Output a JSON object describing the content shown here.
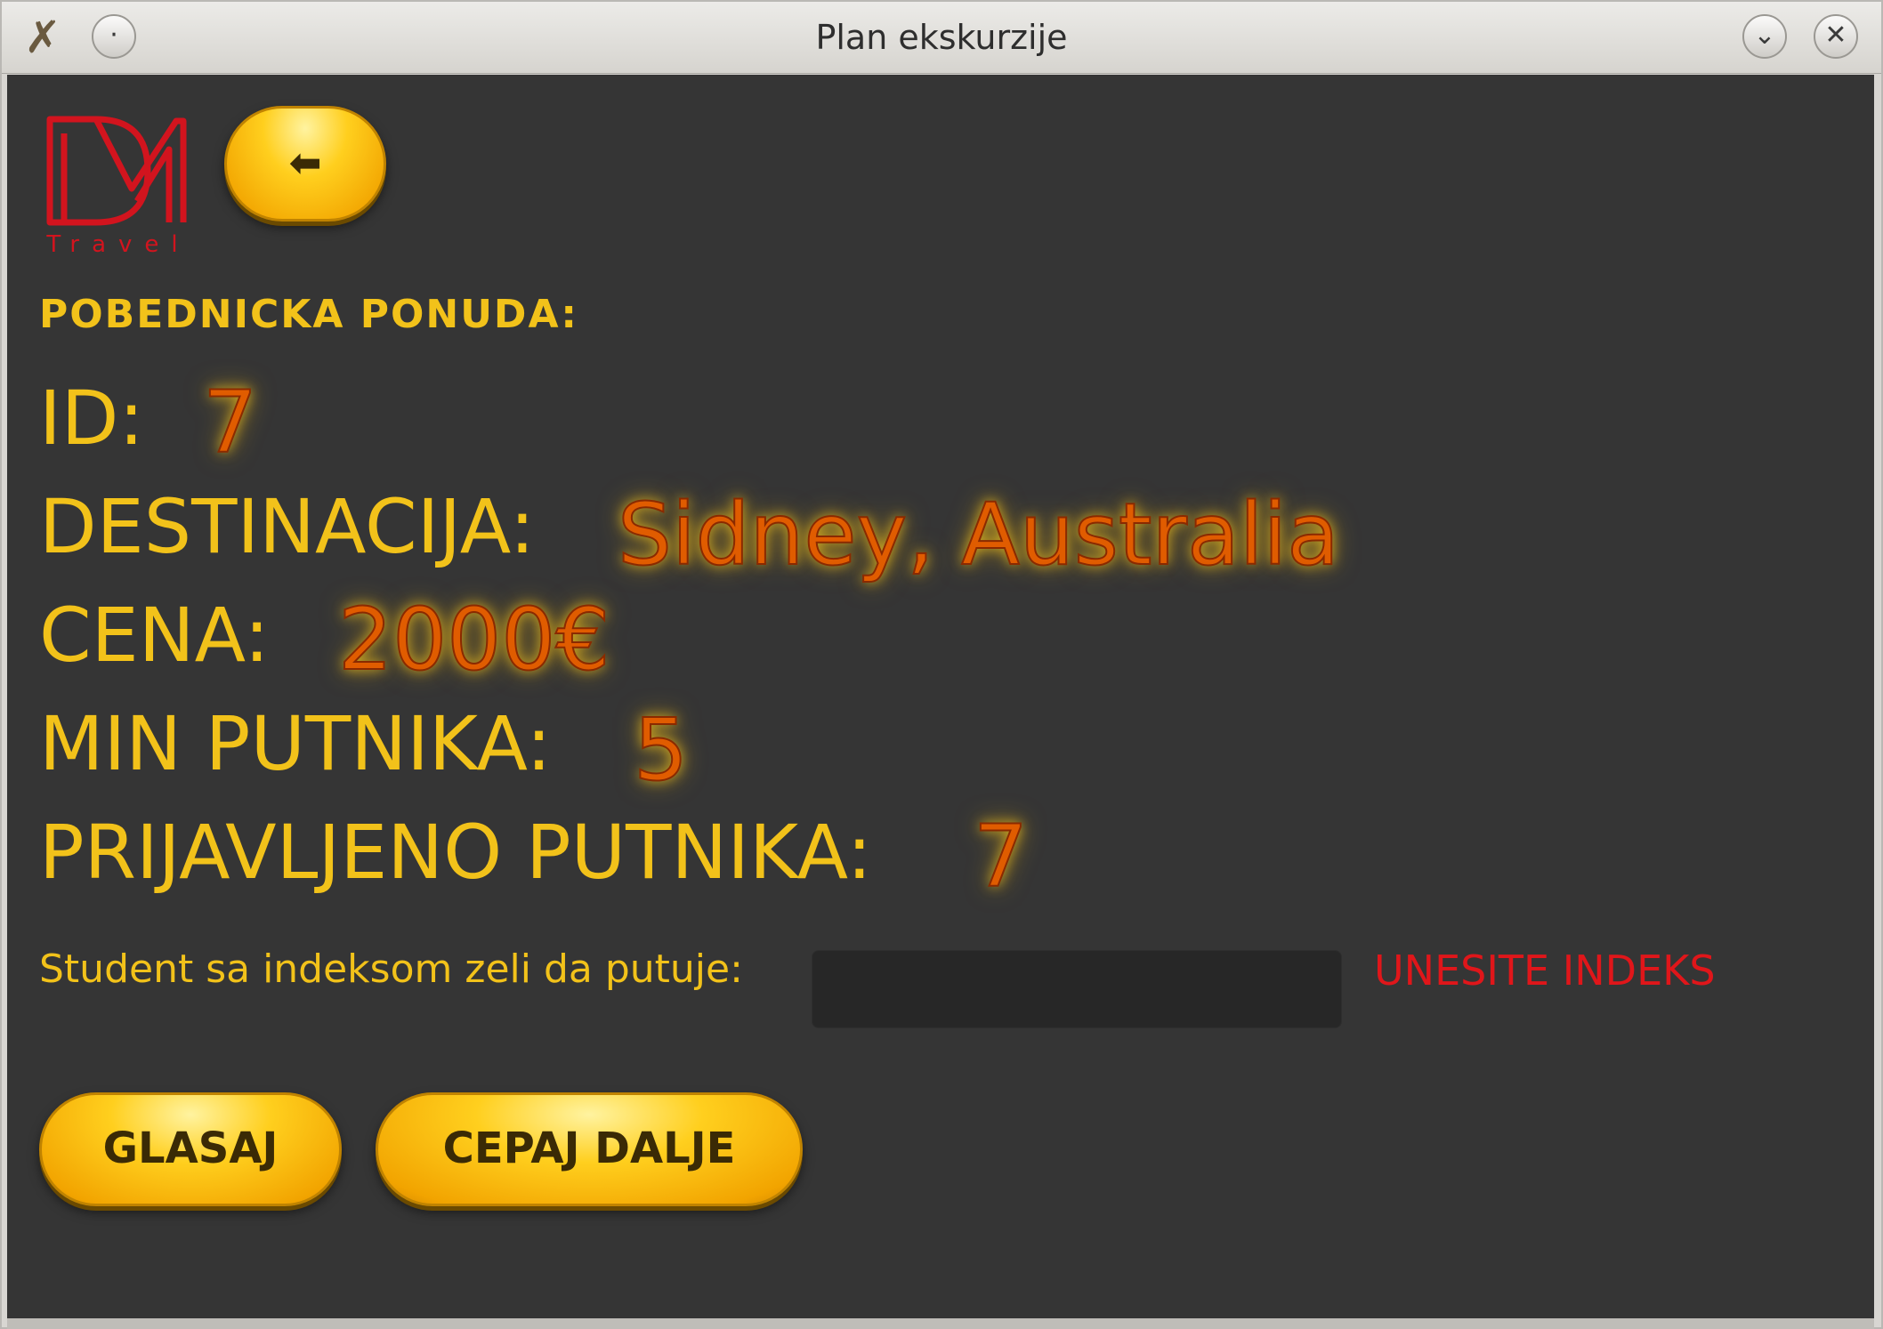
{
  "window": {
    "title": "Plan ekskurzije",
    "app_icon": "xfce-app-icon",
    "controls": [
      "menu-dot-icon",
      "minimize-chevron-icon",
      "close-icon"
    ],
    "control_glyphs": {
      "menu": "·",
      "minimize": "⌄",
      "close": "✕"
    }
  },
  "logo": {
    "text": "Travel",
    "color": "#d2141e"
  },
  "toolbar": {
    "back_label": "⬅"
  },
  "offer": {
    "heading": "POBEDNICKA PONUDA:",
    "id_label": "ID:",
    "id_value": "7",
    "destination_label": "DESTINACIJA:",
    "destination_value": "Sidney, Australia",
    "price_label": "CENA:",
    "price_value": "2000€",
    "min_label": "MIN PUTNIKA:",
    "min_value": "5",
    "registered_label": "PRIJAVLJENO PUTNIKA:",
    "registered_value": "7"
  },
  "student": {
    "prompt": "Student sa indeksom zeli da putuje:",
    "input_value": "",
    "error": "UNESITE INDEKS"
  },
  "actions": {
    "vote_label": "GLASAJ",
    "tear_label": "CEPAJ DALJE"
  },
  "colors": {
    "background": "#353535",
    "label": "#f2c21a",
    "value": "#e05c00",
    "error": "#e0161a",
    "button": "#ffcf1e"
  }
}
